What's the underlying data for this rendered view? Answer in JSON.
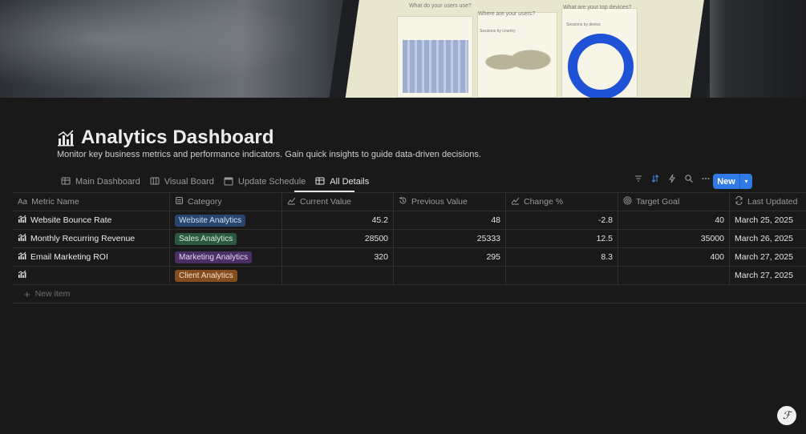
{
  "cover": {
    "labels": [
      "What do your users use?",
      "Where are your users?",
      "What are your top devices?",
      "Sessions by country",
      "Sessions by device"
    ]
  },
  "page": {
    "title": "Analytics Dashboard",
    "description": "Monitor key business metrics and performance indicators. Gain quick insights to guide data-driven decisions.",
    "title_icon": "chart-icon"
  },
  "tabs": [
    {
      "label": "Main Dashboard",
      "icon": "table-icon",
      "active": false
    },
    {
      "label": "Visual Board",
      "icon": "board-icon",
      "active": false
    },
    {
      "label": "Update Schedule",
      "icon": "calendar-icon",
      "active": false
    },
    {
      "label": "All Details",
      "icon": "table-icon",
      "active": true
    }
  ],
  "toolbar": {
    "icons": [
      "filter-icon",
      "sort-icon",
      "automation-icon",
      "search-icon",
      "more-icon"
    ],
    "new_label": "New"
  },
  "table": {
    "columns": [
      {
        "label": "Metric Name",
        "icon": "text-icon"
      },
      {
        "label": "Category",
        "icon": "select-icon"
      },
      {
        "label": "Current Value",
        "icon": "trend-icon"
      },
      {
        "label": "Previous Value",
        "icon": "history-icon"
      },
      {
        "label": "Change %",
        "icon": "trend-icon"
      },
      {
        "label": "Target Goal",
        "icon": "target-icon"
      },
      {
        "label": "Last Updated",
        "icon": "refresh-icon"
      }
    ],
    "rows": [
      {
        "name": "Website Bounce Rate",
        "category": "Website Analytics",
        "category_color": "#28456c",
        "category_text": "#cfe0f5",
        "current": "45.2",
        "previous": "48",
        "change": "-2.8",
        "target": "40",
        "updated": "March 25, 2025"
      },
      {
        "name": "Monthly Recurring Revenue",
        "category": "Sales Analytics",
        "category_color": "#2b593f",
        "category_text": "#d2ecd9",
        "current": "28500",
        "previous": "25333",
        "change": "12.5",
        "target": "35000",
        "updated": "March 26, 2025"
      },
      {
        "name": "Email Marketing ROI",
        "category": "Marketing Analytics",
        "category_color": "#492f64",
        "category_text": "#e7d6f5",
        "current": "320",
        "previous": "295",
        "change": "8.3",
        "target": "400",
        "updated": "March 27, 2025"
      },
      {
        "name": "",
        "category": "Client Analytics",
        "category_color": "#854c1d",
        "category_text": "#f3dfc9",
        "current": "",
        "previous": "",
        "change": "",
        "target": "",
        "updated": "March 27, 2025"
      }
    ],
    "new_item_label": "New item"
  },
  "help_label": "?"
}
